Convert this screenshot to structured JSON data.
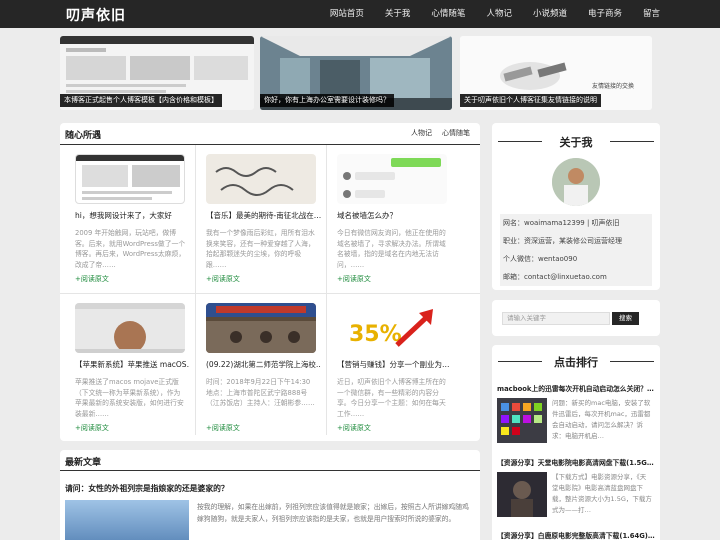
{
  "site": {
    "logo": "叨声依旧",
    "nav": [
      "网站首页",
      "关于我",
      "心情随笔",
      "人物记",
      "小说频道",
      "电子商务",
      "留言"
    ]
  },
  "slides": [
    {
      "caption": "本博客正式起售个人博客模板【内含价格和模板】"
    },
    {
      "caption": "你好，你有上海办公室需要设计装修吗？"
    },
    {
      "caption": "关于叨声依旧个人博客征集友情链接的说明",
      "overlay_text": "友情链接的交换"
    }
  ],
  "random": {
    "title": "随心所遇",
    "tabs": [
      "人物记",
      "心情随笔"
    ],
    "posts": [
      {
        "title": "hi，想我网设计来了，大家好",
        "excerpt": "2009 年开始触网，玩站吧，做博客。后来，就用WordPress做了一个博客。再后来，WordPress太麻烦，改成了帝……",
        "more": "+阅读原文"
      },
      {
        "title": "【音乐】最美的期待-南征北战在…",
        "excerpt": "我有一个梦像雨后彩虹，用所有泪水换来笑容，还有一种爱穿越了人海，拾起那颗迷失的尘埃，你的呼吸跟……",
        "more": "+阅读原文"
      },
      {
        "title": "域名被墙怎么办？",
        "excerpt": "今日有微信网友询问，他正在使用的域名被墙了，寻求解决办法。所谓域名被墙，指的是域名在内地无法访问，……",
        "more": "+阅读原文"
      },
      {
        "title": "【苹果新系统】苹果推送 macOS…",
        "excerpt": "苹果推送了macos mojave正式版（下文统一称为苹果新系统），作为苹果最新的系统安装版，如何进行安装最新……",
        "more": "+阅读原文"
      },
      {
        "title": "(09.22)湖北第二师范学院上海校…",
        "excerpt": "时间：2018年9月22日下午14:30 地点：上海市普陀区武宁路888号（江苏饭店）主持人：汪朝彬参……",
        "more": "+阅读原文"
      },
      {
        "title": "【营销与赚钱】分享一个副业为…",
        "excerpt": "近日，叨声依旧个人博客博主所在的一个微信群，有一些精彩的内容分享。今日分享一个主题：如何在每天工作……",
        "more": "+阅读原文"
      }
    ]
  },
  "latest": {
    "title": "最新文章",
    "post_title": "请问：女性的外祖列宗是指娘家的还是婆家的？",
    "post_excerpt": "按我的理解，如果在出嫁前，列祖列宗应该值得就是娘家；出嫁后，按照古人所讲嫁鸡随鸡嫁狗随狗，就是夫家人，列祖列宗应该指的是夫家，也就是用户搜索时所说的婆家的。"
  },
  "about": {
    "title": "关于我",
    "rows": [
      "网名：woaimama12399 | 叨声依旧",
      "职业：资深运营，某装修公司运营经理",
      "个人微信：wentao090",
      "邮箱：contact@linxuetao.com"
    ]
  },
  "search": {
    "placeholder": "请输入关键字",
    "button": "搜索"
  },
  "hot": {
    "title": "点击排行",
    "items": [
      {
        "title": "macbook上的迅雷每次开机自动启动怎么关闭？…",
        "excerpt": "问题：新买的mac电脑，安装了软件迅雷后，每次开机mac，迅雷都会自动启动，请问怎么解决？诉求：电脑开机启…"
      },
      {
        "title": "【资源分享】天堂电影院电影高清网盘下载(1.5G…",
        "excerpt": "【下载方式】电影资源分享，《天堂电影院》电影高清蓝盘网盘下载，整片资源大小为1.5G，下载方式为——打…"
      },
      {
        "title": "【资源分享】白鹿原电影完整版高清下载(1.64G)…",
        "excerpt": ""
      }
    ]
  },
  "colors": {
    "nav_bg": "#262626",
    "accent": "#1b8a3a"
  }
}
